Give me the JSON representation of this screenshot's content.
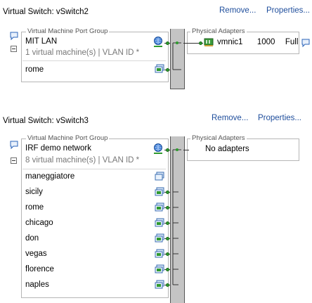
{
  "switches": [
    {
      "title": "Virtual Switch: vSwitch2",
      "remove_label": "Remove...",
      "properties_label": "Properties...",
      "port_group_legend": "Virtual Machine Port Group",
      "port_group_name": "MIT LAN",
      "port_group_sub": "1 virtual machine(s) | VLAN ID *",
      "vms": [
        "rome"
      ],
      "physical_legend": "Physical Adapters",
      "adapter": {
        "name": "vmnic1",
        "speed": "1000",
        "duplex": "Full"
      }
    },
    {
      "title": "Virtual Switch: vSwitch3",
      "remove_label": "Remove...",
      "properties_label": "Properties...",
      "port_group_legend": "Virtual Machine Port Group",
      "port_group_name": "IRF demo network",
      "port_group_sub": "8 virtual machine(s) | VLAN ID *",
      "vms": [
        "maneggiatore",
        "sicily",
        "rome",
        "chicago",
        "don",
        "vegas",
        "florence",
        "naples"
      ],
      "physical_legend": "Physical Adapters",
      "no_adapters_label": "No adapters"
    }
  ],
  "colors": {
    "link": "#1f4e9c",
    "port_dot": "#2e9a2e",
    "bar": "#c4c4c4"
  }
}
